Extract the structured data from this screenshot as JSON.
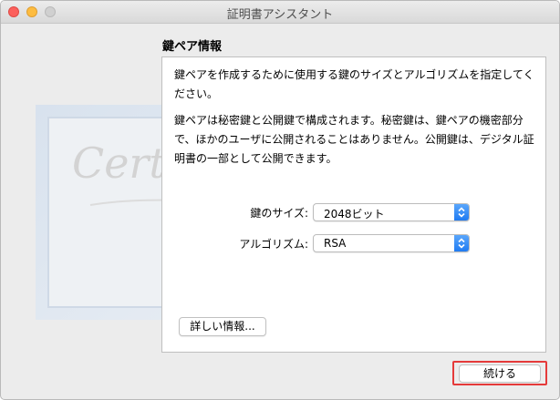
{
  "window": {
    "title": "証明書アシスタント"
  },
  "background": {
    "certificate_art": "Certificate"
  },
  "section": {
    "title": "鍵ペア情報"
  },
  "panel": {
    "description1": "鍵ペアを作成するために使用する鍵のサイズとアルゴリズムを指定してください。",
    "description2": "鍵ペアは秘密鍵と公開鍵で構成されます。秘密鍵は、鍵ペアの機密部分で、ほかのユーザに公開されることはありません。公開鍵は、デジタル証明書の一部として公開できます。"
  },
  "form": {
    "key_size_label": "鍵のサイズ:",
    "key_size_value": "2048ビット",
    "algorithm_label": "アルゴリズム:",
    "algorithm_value": "RSA"
  },
  "buttons": {
    "details_label": "詳しい情報...",
    "continue_label": "続ける"
  },
  "colors": {
    "highlight": "#e53a3a",
    "select_accent": "#2a86f5"
  },
  "icons": [
    "close-button",
    "minimize-button",
    "zoom-button",
    "select-arrows-icon"
  ]
}
